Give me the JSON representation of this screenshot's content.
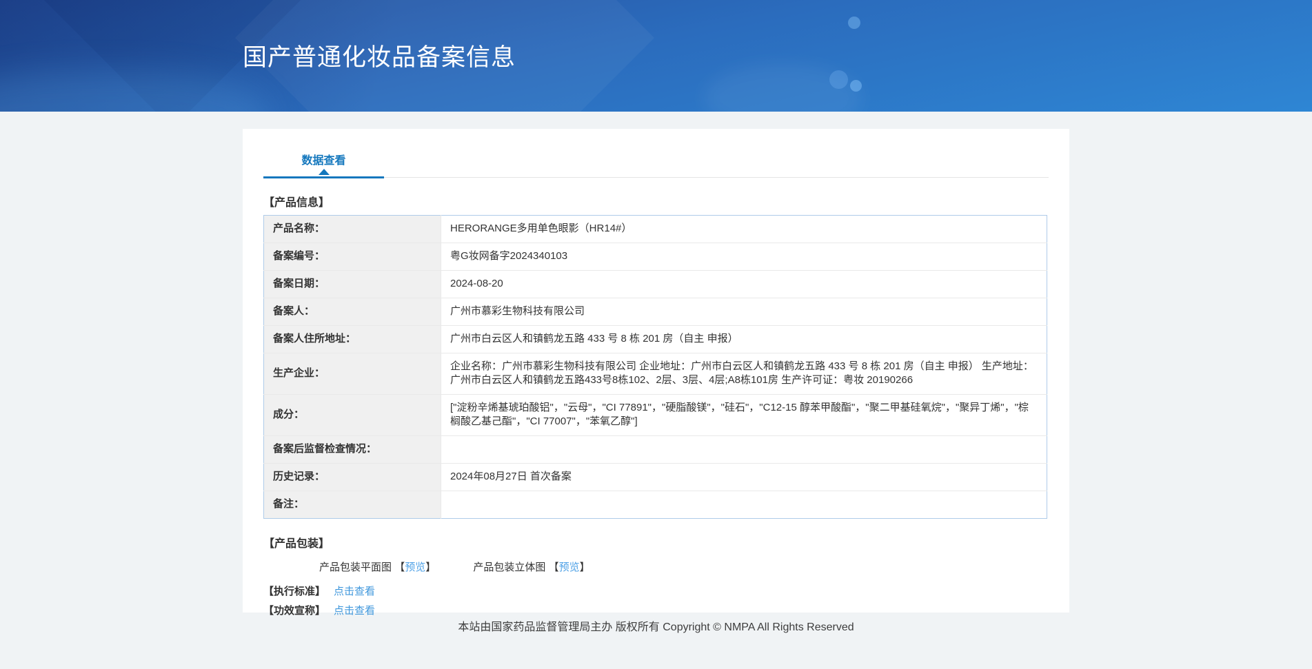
{
  "header": {
    "title": "国产普通化妆品备案信息"
  },
  "tabs": {
    "data_view": "数据查看"
  },
  "product_info": {
    "section_title": "【产品信息】",
    "rows": [
      {
        "label": "产品名称：",
        "value": "HERORANGE多用单色眼影（HR14#）"
      },
      {
        "label": "备案编号：",
        "value": "粤G妆网备字2024340103"
      },
      {
        "label": "备案日期：",
        "value": "2024-08-20"
      },
      {
        "label": "备案人：",
        "value": "广州市慕彩生物科技有限公司"
      },
      {
        "label": "备案人住所地址：",
        "value": "广州市白云区人和镇鹤龙五路 433 号 8 栋 201 房（自主 申报）"
      },
      {
        "label": "生产企业：",
        "value": "企业名称：广州市慕彩生物科技有限公司 企业地址：广州市白云区人和镇鹤龙五路 433 号 8 栋 201 房（自主 申报） 生产地址：广州市白云区人和镇鹤龙五路433号8栋102、2层、3层、4层;A8栋101房 生产许可证：粤妆 20190266"
      },
      {
        "label": "成分：",
        "value": "[\"淀粉辛烯基琥珀酸铝\"，\"云母\"，\"CI 77891\"，\"硬脂酸镁\"，\"硅石\"，\"C12-15 醇苯甲酸酯\"，\"聚二甲基硅氧烷\"，\"聚异丁烯\"，\"棕榈酸乙基己酯\"，\"CI 77007\"，\"苯氧乙醇\"]"
      },
      {
        "label": "备案后监督检查情况：",
        "value": ""
      },
      {
        "label": "历史记录：",
        "value": "2024年08月27日 首次备案"
      },
      {
        "label": "备注：",
        "value": ""
      }
    ]
  },
  "packaging": {
    "section_title": "【产品包装】",
    "flat_label": "产品包装平面图",
    "stereo_label": "产品包装立体图",
    "bracket_open": "【",
    "preview_label": "预览",
    "bracket_close": "】"
  },
  "standard": {
    "section_title": "【执行标准】",
    "link_label": "点击查看"
  },
  "efficacy": {
    "section_title": "【功效宣称】",
    "link_label": "点击查看"
  },
  "footer": {
    "text": "本站由国家药品监督管理局主办 版权所有 Copyright © NMPA All Rights Reserved"
  },
  "colors": {
    "accent_blue": "#1377bd",
    "link_blue": "#3f97dc",
    "preview_link_blue": "#4da0e6",
    "table_border": "#aecbe9",
    "page_bg": "#f0f3f5",
    "header_gradient_top": "#254f9c",
    "header_gradient_bottom": "#2e86d4"
  }
}
